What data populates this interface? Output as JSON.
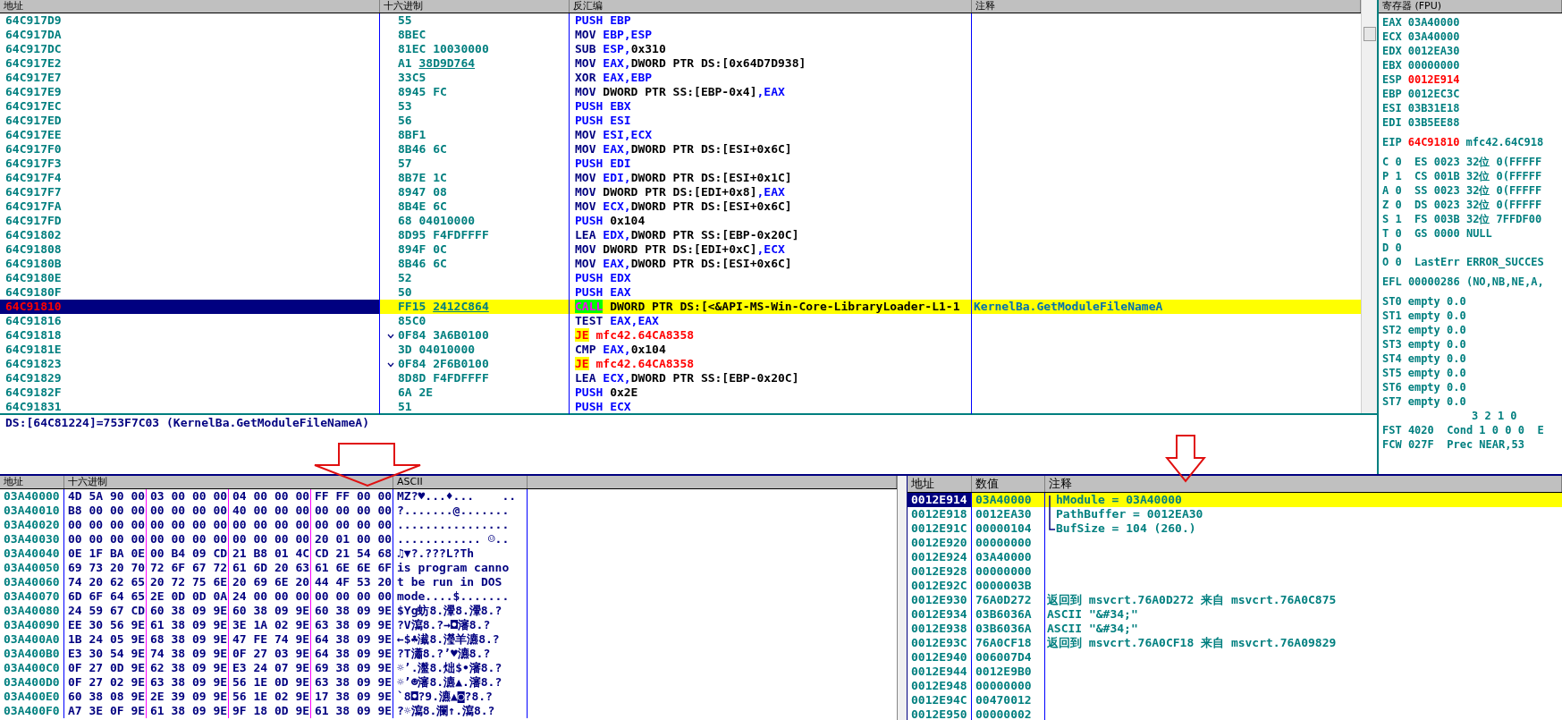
{
  "disassembly": {
    "columns": [
      "地址",
      "十六进制",
      "反汇编",
      "注释"
    ],
    "rows": [
      {
        "address": "64C917D9",
        "hex": "55",
        "mnemonic": "PUSH",
        "kind": "stack",
        "operands": [
          {
            "text": "EBP",
            "kind": "reg"
          }
        ],
        "selected": false
      },
      {
        "address": "64C917DA",
        "hex": "8BEC",
        "mnemonic": "MOV",
        "kind": "plain",
        "operands": [
          {
            "text": "EBP,ESP",
            "kind": "reg"
          }
        ],
        "selected": false
      },
      {
        "address": "64C917DC",
        "hex": "81EC 10030000",
        "mnemonic": "SUB",
        "kind": "plain",
        "operands": [
          {
            "text": "ESP,",
            "kind": "reg"
          },
          {
            "text": "0x310",
            "kind": "mem"
          }
        ],
        "selected": false
      },
      {
        "address": "64C917E2",
        "hex": "A1",
        "hex_link": "38D9D764",
        "mnemonic": "MOV",
        "kind": "plain",
        "operands": [
          {
            "text": "EAX,",
            "kind": "reg"
          },
          {
            "text": "DWORD PTR DS:[0x64D7D938]",
            "kind": "mem"
          }
        ],
        "selected": false
      },
      {
        "address": "64C917E7",
        "hex": "33C5",
        "mnemonic": "XOR",
        "kind": "plain",
        "operands": [
          {
            "text": "EAX,EBP",
            "kind": "reg"
          }
        ],
        "selected": false
      },
      {
        "address": "64C917E9",
        "hex": "8945 FC",
        "mnemonic": "MOV",
        "kind": "plain",
        "operands": [
          {
            "text": "DWORD PTR SS:[EBP-0x4]",
            "kind": "mem"
          },
          {
            "text": ",EAX",
            "kind": "reg"
          }
        ],
        "selected": false
      },
      {
        "address": "64C917EC",
        "hex": "53",
        "mnemonic": "PUSH",
        "kind": "stack",
        "operands": [
          {
            "text": "EBX",
            "kind": "reg"
          }
        ],
        "selected": false
      },
      {
        "address": "64C917ED",
        "hex": "56",
        "mnemonic": "PUSH",
        "kind": "stack",
        "operands": [
          {
            "text": "ESI",
            "kind": "reg"
          }
        ],
        "selected": false
      },
      {
        "address": "64C917EE",
        "hex": "8BF1",
        "mnemonic": "MOV",
        "kind": "plain",
        "operands": [
          {
            "text": "ESI,ECX",
            "kind": "reg"
          }
        ],
        "selected": false
      },
      {
        "address": "64C917F0",
        "hex": "8B46 6C",
        "mnemonic": "MOV",
        "kind": "plain",
        "operands": [
          {
            "text": "EAX,",
            "kind": "reg"
          },
          {
            "text": "DWORD PTR DS:[ESI+0x6C]",
            "kind": "mem"
          }
        ],
        "selected": false
      },
      {
        "address": "64C917F3",
        "hex": "57",
        "mnemonic": "PUSH",
        "kind": "stack",
        "operands": [
          {
            "text": "EDI",
            "kind": "reg"
          }
        ],
        "selected": false
      },
      {
        "address": "64C917F4",
        "hex": "8B7E 1C",
        "mnemonic": "MOV",
        "kind": "plain",
        "operands": [
          {
            "text": "EDI,",
            "kind": "reg"
          },
          {
            "text": "DWORD PTR DS:[ESI+0x1C]",
            "kind": "mem"
          }
        ],
        "selected": false
      },
      {
        "address": "64C917F7",
        "hex": "8947 08",
        "mnemonic": "MOV",
        "kind": "plain",
        "operands": [
          {
            "text": "DWORD PTR DS:[EDI+0x8]",
            "kind": "mem"
          },
          {
            "text": ",EAX",
            "kind": "reg"
          }
        ],
        "selected": false
      },
      {
        "address": "64C917FA",
        "hex": "8B4E 6C",
        "mnemonic": "MOV",
        "kind": "plain",
        "operands": [
          {
            "text": "ECX,",
            "kind": "reg"
          },
          {
            "text": "DWORD PTR DS:[ESI+0x6C]",
            "kind": "mem"
          }
        ],
        "selected": false
      },
      {
        "address": "64C917FD",
        "hex": "68 04010000",
        "mnemonic": "PUSH",
        "kind": "stack",
        "operands": [
          {
            "text": "0x104",
            "kind": "mem"
          }
        ],
        "selected": false
      },
      {
        "address": "64C91802",
        "hex": "8D95 F4FDFFFF",
        "mnemonic": "LEA",
        "kind": "plain",
        "operands": [
          {
            "text": "EDX,",
            "kind": "reg"
          },
          {
            "text": "DWORD PTR SS:[EBP-0x20C]",
            "kind": "mem"
          }
        ],
        "selected": false
      },
      {
        "address": "64C91808",
        "hex": "894F 0C",
        "mnemonic": "MOV",
        "kind": "plain",
        "operands": [
          {
            "text": "DWORD PTR DS:[EDI+0xC]",
            "kind": "mem"
          },
          {
            "text": ",ECX",
            "kind": "reg"
          }
        ],
        "selected": false
      },
      {
        "address": "64C9180B",
        "hex": "8B46 6C",
        "mnemonic": "MOV",
        "kind": "plain",
        "operands": [
          {
            "text": "EAX,",
            "kind": "reg"
          },
          {
            "text": "DWORD PTR DS:[ESI+0x6C]",
            "kind": "mem"
          }
        ],
        "selected": false
      },
      {
        "address": "64C9180E",
        "hex": "52",
        "mnemonic": "PUSH",
        "kind": "stack",
        "operands": [
          {
            "text": "EDX",
            "kind": "reg"
          }
        ],
        "selected": false
      },
      {
        "address": "64C9180F",
        "hex": "50",
        "mnemonic": "PUSH",
        "kind": "stack",
        "operands": [
          {
            "text": "EAX",
            "kind": "reg"
          }
        ],
        "selected": false
      },
      {
        "address": "64C91810",
        "hex": "FF15",
        "hex_link": "2412C864",
        "mnemonic": "CALL",
        "kind": "call",
        "operands": [
          {
            "text": "DWORD PTR DS:[<&API-MS-Win-Core-LibraryLoader-L1-1",
            "kind": "mem"
          }
        ],
        "comment": "KernelBa.GetModuleFileNameA",
        "selected": true
      },
      {
        "address": "64C91816",
        "hex": "85C0",
        "mnemonic": "TEST",
        "kind": "plain",
        "operands": [
          {
            "text": "EAX,EAX",
            "kind": "reg"
          }
        ],
        "selected": false
      },
      {
        "address": "64C91818",
        "hex": "0F84 3A6B0100",
        "jump": true,
        "mnemonic": "JE",
        "kind": "jump",
        "operands": [
          {
            "text": "mfc42.64CA8358",
            "kind": "target"
          }
        ],
        "selected": false
      },
      {
        "address": "64C9181E",
        "hex": "3D 04010000",
        "mnemonic": "CMP",
        "kind": "plain",
        "operands": [
          {
            "text": "EAX,",
            "kind": "reg"
          },
          {
            "text": "0x104",
            "kind": "mem"
          }
        ],
        "selected": false
      },
      {
        "address": "64C91823",
        "hex": "0F84 2F6B0100",
        "jump": true,
        "mnemonic": "JE",
        "kind": "jump",
        "operands": [
          {
            "text": "mfc42.64CA8358",
            "kind": "target"
          }
        ],
        "selected": false
      },
      {
        "address": "64C91829",
        "hex": "8D8D F4FDFFFF",
        "mnemonic": "LEA",
        "kind": "plain",
        "operands": [
          {
            "text": "ECX,",
            "kind": "reg"
          },
          {
            "text": "DWORD PTR SS:[EBP-0x20C]",
            "kind": "mem"
          }
        ],
        "selected": false
      },
      {
        "address": "64C9182F",
        "hex": "6A 2E",
        "mnemonic": "PUSH",
        "kind": "stack",
        "operands": [
          {
            "text": "0x2E",
            "kind": "mem"
          }
        ],
        "selected": false
      },
      {
        "address": "64C91831",
        "hex": "51",
        "mnemonic": "PUSH",
        "kind": "stack",
        "operands": [
          {
            "text": "ECX",
            "kind": "reg"
          }
        ],
        "selected": false
      }
    ]
  },
  "registers": {
    "title": "寄存器 (FPU)",
    "general": [
      {
        "name": "EAX",
        "value": "03A40000",
        "changed": false
      },
      {
        "name": "ECX",
        "value": "03A40000",
        "changed": false
      },
      {
        "name": "EDX",
        "value": "0012EA30",
        "changed": false
      },
      {
        "name": "EBX",
        "value": "00000000",
        "changed": false
      },
      {
        "name": "ESP",
        "value": "0012E914",
        "changed": true
      },
      {
        "name": "EBP",
        "value": "0012EC3C",
        "changed": false
      },
      {
        "name": "ESI",
        "value": "03B31E18",
        "changed": false
      },
      {
        "name": "EDI",
        "value": "03B5EE88",
        "changed": false
      }
    ],
    "eip": {
      "name": "EIP",
      "value": "64C91810",
      "changed": true,
      "note": "mfc42.64C918"
    },
    "flags": [
      "C 0  ES 0023 32位 0(FFFFF",
      "P 1  CS 001B 32位 0(FFFFF",
      "A 0  SS 0023 32位 0(FFFFF",
      "Z 0  DS 0023 32位 0(FFFFF",
      "S 1  FS 003B 32位 7FFDF00",
      "T 0  GS 0000 NULL",
      "D 0",
      "O 0  LastErr ERROR_SUCCES"
    ],
    "efl": "EFL 00000286 (NO,NB,NE,A,",
    "fpu": [
      {
        "name": "ST0",
        "value": "empty 0.0"
      },
      {
        "name": "ST1",
        "value": "empty 0.0"
      },
      {
        "name": "ST2",
        "value": "empty 0.0"
      },
      {
        "name": "ST3",
        "value": "empty 0.0"
      },
      {
        "name": "ST4",
        "value": "empty 0.0"
      },
      {
        "name": "ST5",
        "value": "empty 0.0"
      },
      {
        "name": "ST6",
        "value": "empty 0.0"
      },
      {
        "name": "ST7",
        "value": "empty 0.0"
      }
    ],
    "fpu_status": [
      "3 2 1 0",
      "FST 4020  Cond 1 0 0 0  E",
      "FCW 027F  Prec NEAR,53"
    ]
  },
  "info_line": "DS:[64C81224]=753F7C03 (KernelBa.GetModuleFileNameA)",
  "memory": {
    "columns": [
      "地址",
      "十六进制",
      "ASCII"
    ],
    "rows": [
      {
        "address": "03A40000",
        "bytes": [
          "4D 5A 90 00",
          "03 00 00 00",
          "04 00 00 00",
          "FF FF 00 00"
        ],
        "ascii": "MZ?♥...♦...    .."
      },
      {
        "address": "03A40010",
        "bytes": [
          "B8 00 00 00",
          "00 00 00 00",
          "40 00 00 00",
          "00 00 00 00"
        ],
        "ascii": "?.......@......."
      },
      {
        "address": "03A40020",
        "bytes": [
          "00 00 00 00",
          "00 00 00 00",
          "00 00 00 00",
          "00 00 00 00"
        ],
        "ascii": "................"
      },
      {
        "address": "03A40030",
        "bytes": [
          "00 00 00 00",
          "00 00 00 00",
          "00 00 00 00",
          "20 01 00 00"
        ],
        "ascii": "............ ☺.."
      },
      {
        "address": "03A40040",
        "bytes": [
          "0E 1F BA 0E",
          "00 B4 09 CD",
          "21 B8 01 4C",
          "CD 21 54 68"
        ],
        "ascii": "♫▼?.???L?Th"
      },
      {
        "address": "03A40050",
        "bytes": [
          "69 73 20 70",
          "72 6F 67 72",
          "61 6D 20 63",
          "61 6E 6E 6F"
        ],
        "ascii": "is program canno"
      },
      {
        "address": "03A40060",
        "bytes": [
          "74 20 62 65",
          "20 72 75 6E",
          "20 69 6E 20",
          "44 4F 53 20"
        ],
        "ascii": "t be run in DOS"
      },
      {
        "address": "03A40070",
        "bytes": [
          "6D 6F 64 65",
          "2E 0D 0D 0A",
          "24 00 00 00",
          "00 00 00 00"
        ],
        "ascii": "mode....$......."
      },
      {
        "address": "03A40080",
        "bytes": [
          "24 59 67 CD",
          "60 38 09 9E",
          "60 38 09 9E",
          "60 38 09 9E"
        ],
        "ascii": "$Yg蚄8.瀈8.瀈8.?"
      },
      {
        "address": "03A40090",
        "bytes": [
          "EE 30 56 9E",
          "61 38 09 9E",
          "3E 1A 02 9E",
          "63 38 09 9E"
        ],
        "ascii": "?V瀉8.?→◘瀋8.?"
      },
      {
        "address": "03A400A0",
        "bytes": [
          "1B 24 05 9E",
          "68 38 09 9E",
          "47 FE 74 9E",
          "64 38 09 9E"
        ],
        "ascii": "←$♣瀐8.瀅羊瀌8.?"
      },
      {
        "address": "03A400B0",
        "bytes": [
          "E3 30 54 9E",
          "74 38 09 9E",
          "0F 27 03 9E",
          "64 38 09 9E"
        ],
        "ascii": "?T瀟8.?’♥瀌8.?"
      },
      {
        "address": "03A400C0",
        "bytes": [
          "0F 27 0D 9E",
          "62 38 09 9E",
          "E3 24 07 9E",
          "69 38 09 9E"
        ],
        "ascii": "☼’.瀊8.炪$•瀋8.?"
      },
      {
        "address": "03A400D0",
        "bytes": [
          "0F 27 02 9E",
          "63 38 09 9E",
          "56 1E 0D 9E",
          "63 38 09 9E"
        ],
        "ascii": "☼’☻瀋8.瀌▲.瀋8.?"
      },
      {
        "address": "03A400E0",
        "bytes": [
          "60 38 08 9E",
          "2E 39 09 9E",
          "56 1E 02 9E",
          "17 38 09 9E"
        ],
        "ascii": "`8◘?9.瀌▲◙?8.?"
      },
      {
        "address": "03A400F0",
        "bytes": [
          "A7 3E 0F 9E",
          "61 38 09 9E",
          "9F 18 0D 9E",
          "61 38 09 9E"
        ],
        "ascii": "?☼瀉8.瀾↑.瀉8.?"
      }
    ]
  },
  "stack": {
    "columns": [
      "地址",
      "数值",
      "注释"
    ],
    "rows": [
      {
        "address": "0012E914",
        "value": "03A40000",
        "comment": "hModule = 03A40000",
        "kind": "top",
        "selected": true
      },
      {
        "address": "0012E918",
        "value": "0012EA30",
        "comment": "PathBuffer = 0012EA30",
        "kind": "mid",
        "selected": false
      },
      {
        "address": "0012E91C",
        "value": "00000104",
        "comment": "BufSize = 104 (260.)",
        "kind": "bottom",
        "selected": false
      },
      {
        "address": "0012E920",
        "value": "00000000",
        "selected": false
      },
      {
        "address": "0012E924",
        "value": "03A40000",
        "selected": false
      },
      {
        "address": "0012E928",
        "value": "00000000",
        "selected": false
      },
      {
        "address": "0012E92C",
        "value": "0000003B",
        "selected": false
      },
      {
        "address": "0012E930",
        "value": "76A0D272",
        "comment": "返回到 msvcrt.76A0D272 来自 msvcrt.76A0C875",
        "selected": false
      },
      {
        "address": "0012E934",
        "value": "03B6036A",
        "comment": "ASCII \"&#34;\"",
        "selected": false
      },
      {
        "address": "0012E938",
        "value": "03B6036A",
        "comment": "ASCII \"&#34;\"",
        "selected": false
      },
      {
        "address": "0012E93C",
        "value": "76A0CF18",
        "comment": "返回到 msvcrt.76A0CF18 来自 msvcrt.76A09829",
        "selected": false
      },
      {
        "address": "0012E940",
        "value": "006007D4",
        "selected": false
      },
      {
        "address": "0012E944",
        "value": "0012E9B0",
        "selected": false
      },
      {
        "address": "0012E948",
        "value": "00000000",
        "selected": false
      },
      {
        "address": "0012E94C",
        "value": "00470012",
        "selected": false
      },
      {
        "address": "0012E950",
        "value": "00000002",
        "selected": false
      }
    ]
  }
}
